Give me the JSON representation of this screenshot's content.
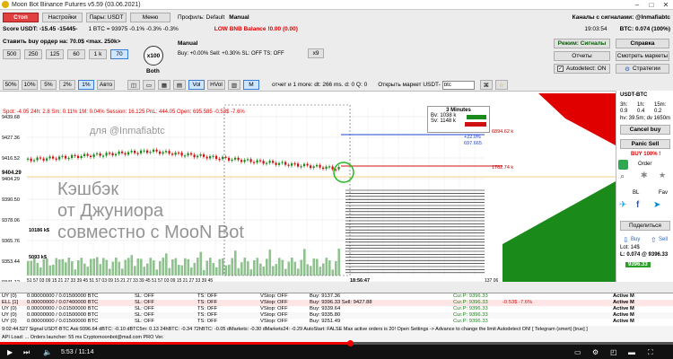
{
  "window": {
    "title": "Moon Bot Binance Futures v5.59 (03.06.2021)"
  },
  "row1": {
    "stop": "Стоп",
    "settings": "Настройки",
    "pairs": "Пары: USDT",
    "menu": "Меню",
    "profile": "Профиль: Default",
    "mode": "Manual",
    "channels": "Каналы с сигналами: @Inmafiabtc"
  },
  "row2": {
    "score": "Score USDT: -15.45 -15445-",
    "btc": "1 BTC = 93975 -0.1% -0.3% -0.3%",
    "low_bnb": "LOW BNB Balance !0.00 (0.00)",
    "time": "19:03:54",
    "btc_pct": "BTC: 0.074 (100%)"
  },
  "row3": {
    "buy_label": "Ставить buy ордер на: 70.0$ <max. 250k>",
    "manual_title": "Manual",
    "manual_line": "Buy: +0.00%  Sell: +0.30%  SL: OFF  TS: OFF",
    "x9": "x9",
    "signals_btn": "Режим: Сигналы",
    "help_btn": "Справка",
    "reports_btn": "Отчеты",
    "markets_btn": "Смотреть маркеты",
    "autodetect_btn": "Autodetect: ON",
    "strategies_btn": "Стратегии"
  },
  "amounts": [
    "500",
    "250",
    "125",
    "60",
    "1 k",
    "70"
  ],
  "x100": {
    "main": "x100",
    "sub": "Both"
  },
  "row4": {
    "pcts": [
      "50%",
      "10%",
      "5%",
      "2%",
      "1%",
      "Авто"
    ],
    "vol": "Vol",
    "hvol": "HVol",
    "m": "M",
    "report": "отчет и 1 more: dt: 266 ms.  d: 0 Q: 0",
    "open_market": "Открыть маркет USDT-",
    "market_input": "btc"
  },
  "chart": {
    "info_line": "Spot: -4.05  24h: 2.8  Sm: 0.11%  1M: 0.04%  Session: 16.125  PnL: 444.05  Open: 695.585  -0.53$  -7.6%",
    "timeframe": "3 Minutes",
    "bv": "Bv: 1038 k",
    "sv": "Sv: 1148 k",
    "price_labels": [
      "9439.68",
      "9427.36",
      "9416.52",
      "9404.29",
      "9390.50",
      "9378.06",
      "9365.76",
      "9353.44",
      "9341.12"
    ],
    "vol_labels": [
      "10186 k$",
      "5093 k$"
    ],
    "order_labels": [
      "6894.62 k",
      "+22.0%",
      "697.665",
      "1762.74 k"
    ],
    "time_axis": "51 57 03 09 15 21 27 33 39 45 51 57 03 09 15 21 27 33 39 45 51 57 03 09 15 21 27 33 39 45",
    "time_now": "18:56:47",
    "time_right": "137 06",
    "watermark": [
      "Кэшбэк",
      "от Джуниора",
      "совместно с  MooN Bot"
    ],
    "wm_top": "для  @Inmafiabtc",
    "colors": {
      "up": "#1a8a1a",
      "down": "#d01010",
      "vol": "#5fa85f"
    }
  },
  "right": {
    "symbol": "USDT-BTC",
    "tf_headers": [
      "3h:",
      "1h:",
      "15m:"
    ],
    "tf_values": [
      "0.9",
      "0.4",
      "0.2"
    ],
    "hv": "hv: 39.5m; dv 1650m",
    "cancel_buy": "Cancel buy",
    "panic_sell": "Panic Sell",
    "buy100": "BUY 100% !",
    "order": "Order",
    "bl": "BL",
    "fav": "Fav",
    "share": "Поделиться",
    "buy": "Buy",
    "sell": "Sell",
    "lot": "Lot: 14$",
    "l": "L: 0.074 @ 9396.33",
    "price": "9396.33"
  },
  "orders": [
    {
      "id": "UY (0)",
      "qty": "0.00000000 / 0.01500000 BTC",
      "sl": "SL: OFF",
      "ts": "TS: OFF",
      "vs": "VStop: OFF",
      "buy": "Buy: 9137.36",
      "cur": "Cur.P: 9396.33",
      "pct": "",
      "st": "Active M"
    },
    {
      "id": "ELL [1]",
      "qty": "0.00000000 / 0.07400000 BTC",
      "sl": "SL: OFF",
      "ts": "TS: OFF",
      "vs": "VStop: OFF",
      "buy": "Buy: 9396.33   Sell: 9427.88",
      "cur": "Cur.P: 9396.33",
      "pct": "-0.53$ -7.6%",
      "st": "Active M"
    },
    {
      "id": "UY (0)",
      "qty": "0.00000000 / 0.01500000 BTC",
      "sl": "SL: OFF",
      "ts": "TS: OFF",
      "vs": "VStop: OFF",
      "buy": "Buy: 9339.64",
      "cur": "Cur.P: 9396.33",
      "pct": "",
      "st": "Active M"
    },
    {
      "id": "UY (0)",
      "qty": "0.00000000 / 0.01500000 BTC",
      "sl": "SL: OFF",
      "ts": "TS: OFF",
      "vs": "VStop: OFF",
      "buy": "Buy: 9335.80",
      "cur": "Cur.P: 9396.33",
      "pct": "",
      "st": "Active M"
    },
    {
      "id": "UY (0)",
      "qty": "0.00000000 / 0.01500000 BTC",
      "sl": "SL: OFF",
      "ts": "TS: OFF",
      "vs": "VStop: OFF",
      "buy": "Buy: 9251.49",
      "cur": "Cur.P: 9396.33",
      "pct": "",
      "st": "Active M"
    }
  ],
  "status": {
    "line1": "9:02:44.527   Signal USDT-BTC Ask:9396.64  dBTC: -0.10  dBTC5m: 0.13  24hBTC: -0.34  72hBTC: -0.05  dMarkets: -0.30  dMarkets24: -0.29    AutoStart: FALSE   Max active orders is 20! Open Settings -> Advance to change the limit   Autodetect ON!  [ Telegram (smert) [true] ]",
    "line2": "API Load: ...   Orders launcher: 55 ms   Cryptomoonbot@mail.com   PRO Ver."
  },
  "player": {
    "time": "5:53 / 11:14",
    "progress": 0.52
  }
}
